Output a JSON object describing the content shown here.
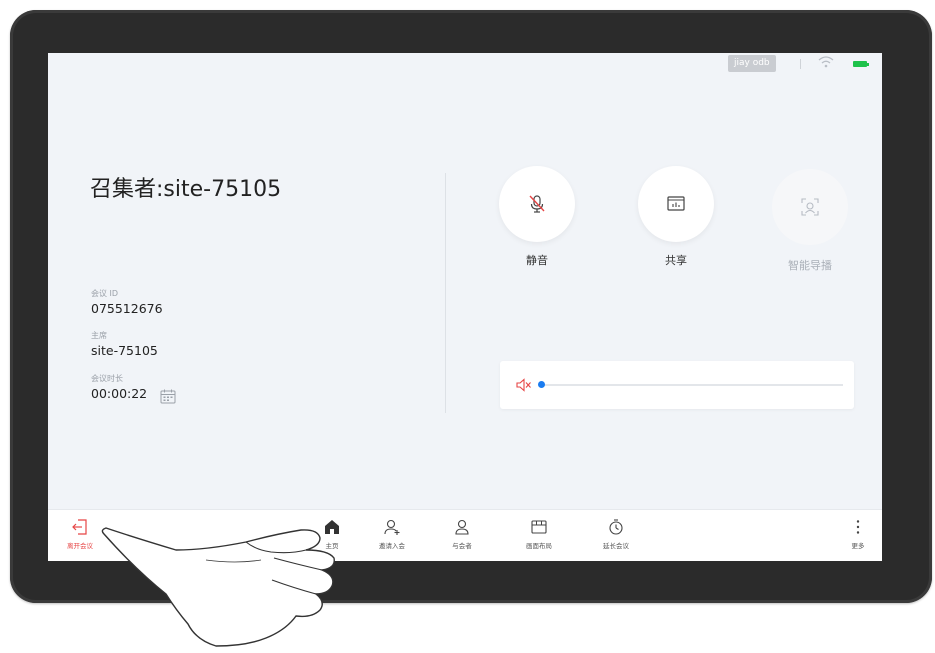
{
  "status": {
    "user": "jiay odb",
    "wifi_icon": "wifi-icon",
    "battery_icon": "battery-icon",
    "battery_color": "#1ec24b"
  },
  "meeting": {
    "title": "召集者:site-75105",
    "id_label": "会议 ID",
    "id_value": "075512676",
    "host_label": "主席",
    "host_value": "site-75105",
    "duration_label": "会议时长",
    "duration_value": "00:00:22"
  },
  "controls": [
    {
      "label": "静音",
      "icon": "mic-muted-icon",
      "enabled": true
    },
    {
      "label": "共享",
      "icon": "share-screen-icon",
      "enabled": true
    },
    {
      "label": "智能导播",
      "icon": "smart-director-icon",
      "enabled": false
    }
  ],
  "volume": {
    "icon": "speaker-muted-icon",
    "level": 0,
    "accent": "#1a7cf0"
  },
  "toolbar": {
    "leave": "离开会议",
    "home": "主页",
    "invite": "邀请入会",
    "participants": "与会者",
    "layout": "画面布局",
    "extend": "延长会议",
    "more": "更多",
    "leave_color": "#e64545"
  }
}
